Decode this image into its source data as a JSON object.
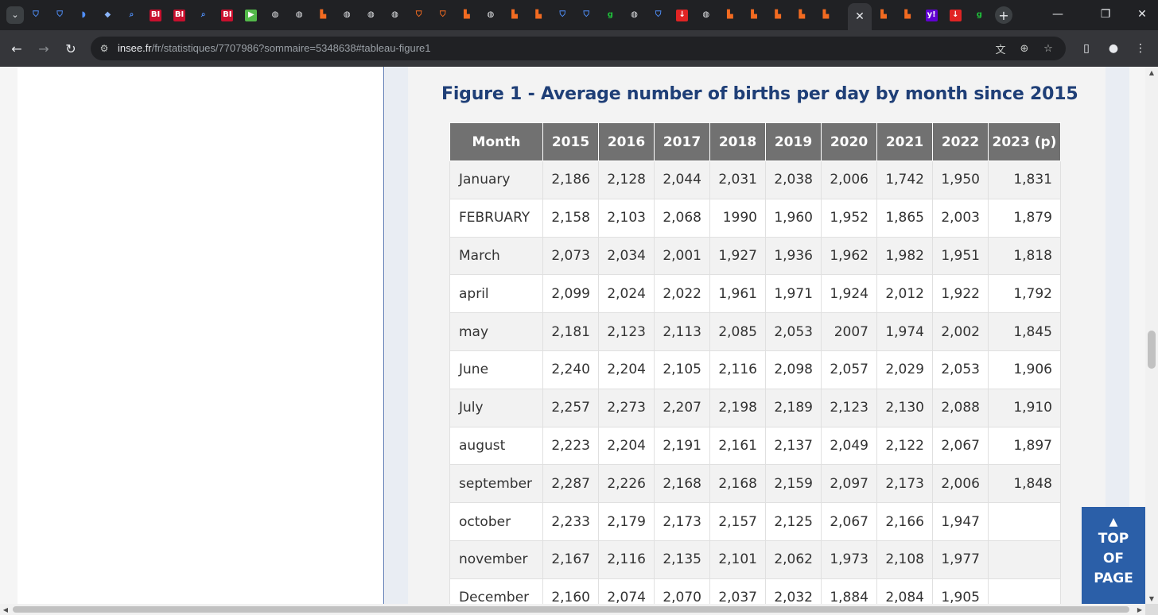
{
  "browser": {
    "tab_favicons": [
      {
        "glyph": "⛉",
        "color": "#4f8ef7",
        "bg": "transparent",
        "name": "shield-favicon-icon"
      },
      {
        "glyph": "⛉",
        "color": "#4f8ef7",
        "bg": "transparent",
        "name": "shield-favicon-icon"
      },
      {
        "glyph": "◗",
        "color": "#4f8ef7",
        "bg": "transparent",
        "name": "bookmark-favicon-icon"
      },
      {
        "glyph": "◆",
        "color": "#8ab4f8",
        "bg": "transparent",
        "name": "diamond-favicon-icon"
      },
      {
        "glyph": "⌕",
        "color": "#4f8ef7",
        "bg": "transparent",
        "name": "search-favicon-icon"
      },
      {
        "glyph": "BI",
        "color": "#ffffff",
        "bg": "#c8102e",
        "name": "bi-favicon-icon"
      },
      {
        "glyph": "BI",
        "color": "#ffffff",
        "bg": "#c8102e",
        "name": "bi-favicon-icon"
      },
      {
        "glyph": "⌕",
        "color": "#4f8ef7",
        "bg": "transparent",
        "name": "search-favicon-icon"
      },
      {
        "glyph": "BI",
        "color": "#ffffff",
        "bg": "#c8102e",
        "name": "bi-favicon-icon"
      },
      {
        "glyph": "▶",
        "color": "#ffffff",
        "bg": "#53b94a",
        "name": "play-favicon-icon"
      },
      {
        "glyph": "◍",
        "color": "#e8eaed",
        "bg": "transparent",
        "name": "globe-favicon-icon"
      },
      {
        "glyph": "◍",
        "color": "#e8eaed",
        "bg": "transparent",
        "name": "globe-favicon-icon"
      },
      {
        "glyph": "▙",
        "color": "#f26b21",
        "bg": "transparent",
        "name": "substack-favicon-icon"
      },
      {
        "glyph": "◍",
        "color": "#e8eaed",
        "bg": "transparent",
        "name": "globe-favicon-icon"
      },
      {
        "glyph": "◍",
        "color": "#e8eaed",
        "bg": "transparent",
        "name": "globe-favicon-icon"
      },
      {
        "glyph": "◍",
        "color": "#e8eaed",
        "bg": "transparent",
        "name": "globe-favicon-icon"
      },
      {
        "glyph": "⛉",
        "color": "#f26b21",
        "bg": "transparent",
        "name": "shield-favicon-icon"
      },
      {
        "glyph": "⛉",
        "color": "#f26b21",
        "bg": "transparent",
        "name": "shield-favicon-icon"
      },
      {
        "glyph": "▙",
        "color": "#f26b21",
        "bg": "transparent",
        "name": "substack-favicon-icon"
      },
      {
        "glyph": "◍",
        "color": "#e8eaed",
        "bg": "transparent",
        "name": "globe-favicon-icon"
      },
      {
        "glyph": "▙",
        "color": "#f26b21",
        "bg": "transparent",
        "name": "substack-favicon-icon"
      },
      {
        "glyph": "▙",
        "color": "#f26b21",
        "bg": "transparent",
        "name": "substack-favicon-icon"
      },
      {
        "glyph": "⛉",
        "color": "#4f8ef7",
        "bg": "transparent",
        "name": "shield-favicon-icon"
      },
      {
        "glyph": "⛉",
        "color": "#4f8ef7",
        "bg": "transparent",
        "name": "shield-favicon-icon"
      },
      {
        "glyph": "g",
        "color": "#1fbf3a",
        "bg": "transparent",
        "name": "g-favicon-icon"
      },
      {
        "glyph": "◍",
        "color": "#e8eaed",
        "bg": "transparent",
        "name": "globe-favicon-icon"
      },
      {
        "glyph": "⛉",
        "color": "#4f8ef7",
        "bg": "transparent",
        "name": "shield-favicon-icon"
      },
      {
        "glyph": "↓",
        "color": "#ffffff",
        "bg": "#e02424",
        "name": "download-favicon-icon"
      },
      {
        "glyph": "◍",
        "color": "#e8eaed",
        "bg": "transparent",
        "name": "globe-favicon-icon"
      },
      {
        "glyph": "▙",
        "color": "#f26b21",
        "bg": "transparent",
        "name": "substack-favicon-icon"
      },
      {
        "glyph": "▙",
        "color": "#f26b21",
        "bg": "transparent",
        "name": "substack-favicon-icon"
      },
      {
        "glyph": "▙",
        "color": "#f26b21",
        "bg": "transparent",
        "name": "substack-favicon-icon"
      },
      {
        "glyph": "▙",
        "color": "#f26b21",
        "bg": "transparent",
        "name": "substack-favicon-icon"
      },
      {
        "glyph": "▙",
        "color": "#f26b21",
        "bg": "transparent",
        "name": "substack-favicon-icon"
      }
    ],
    "tab_favicons_after": [
      {
        "glyph": "▙",
        "color": "#f26b21",
        "bg": "transparent",
        "name": "substack-favicon-icon"
      },
      {
        "glyph": "▙",
        "color": "#f26b21",
        "bg": "transparent",
        "name": "substack-favicon-icon"
      },
      {
        "glyph": "y!",
        "color": "#ffffff",
        "bg": "#6001d2",
        "name": "yahoo-favicon-icon"
      },
      {
        "glyph": "↓",
        "color": "#ffffff",
        "bg": "#e02424",
        "name": "download-favicon-icon"
      },
      {
        "glyph": "g",
        "color": "#1fbf3a",
        "bg": "transparent",
        "name": "g-favicon-icon"
      }
    ],
    "active_tab_close": "✕",
    "new_tab": "+",
    "url_host": "insee.fr",
    "url_path": "/fr/statistiques/7707986?sommaire=5348638#tableau-figure1"
  },
  "page": {
    "figure_title": "Figure 1 - Average number of births per day by month since 2015",
    "table": {
      "headers": [
        "Month",
        "2015",
        "2016",
        "2017",
        "2018",
        "2019",
        "2020",
        "2021",
        "2022",
        "2023 (p)"
      ],
      "rows": [
        [
          "January",
          "2,186",
          "2,128",
          "2,044",
          "2,031",
          "2,038",
          "2,006",
          "1,742",
          "1,950",
          "1,831"
        ],
        [
          "FEBRUARY",
          "2,158",
          "2,103",
          "2,068",
          "1990",
          "1,960",
          "1,952",
          "1,865",
          "2,003",
          "1,879"
        ],
        [
          "March",
          "2,073",
          "2,034",
          "2,001",
          "1,927",
          "1,936",
          "1,962",
          "1,982",
          "1,951",
          "1,818"
        ],
        [
          "april",
          "2,099",
          "2,024",
          "2,022",
          "1,961",
          "1,971",
          "1,924",
          "2,012",
          "1,922",
          "1,792"
        ],
        [
          "may",
          "2,181",
          "2,123",
          "2,113",
          "2,085",
          "2,053",
          "2007",
          "1,974",
          "2,002",
          "1,845"
        ],
        [
          "June",
          "2,240",
          "2,204",
          "2,105",
          "2,116",
          "2,098",
          "2,057",
          "2,029",
          "2,053",
          "1,906"
        ],
        [
          "July",
          "2,257",
          "2,273",
          "2,207",
          "2,198",
          "2,189",
          "2,123",
          "2,130",
          "2,088",
          "1,910"
        ],
        [
          "august",
          "2,223",
          "2,204",
          "2,191",
          "2,161",
          "2,137",
          "2,049",
          "2,122",
          "2,067",
          "1,897"
        ],
        [
          "september",
          "2,287",
          "2,226",
          "2,168",
          "2,168",
          "2,159",
          "2,097",
          "2,173",
          "2,006",
          "1,848"
        ],
        [
          "october",
          "2,233",
          "2,179",
          "2,173",
          "2,157",
          "2,125",
          "2,067",
          "2,166",
          "1,947",
          ""
        ],
        [
          "november",
          "2,167",
          "2,116",
          "2,135",
          "2,101",
          "2,062",
          "1,973",
          "2,108",
          "1,977",
          ""
        ],
        [
          "December",
          "2,160",
          "2,074",
          "2,070",
          "2,037",
          "2,032",
          "1,884",
          "2,084",
          "1,905",
          ""
        ]
      ]
    },
    "top_button": {
      "arrow": "▲",
      "line1": "TOP",
      "line2": "OF",
      "line3": "PAGE"
    }
  }
}
